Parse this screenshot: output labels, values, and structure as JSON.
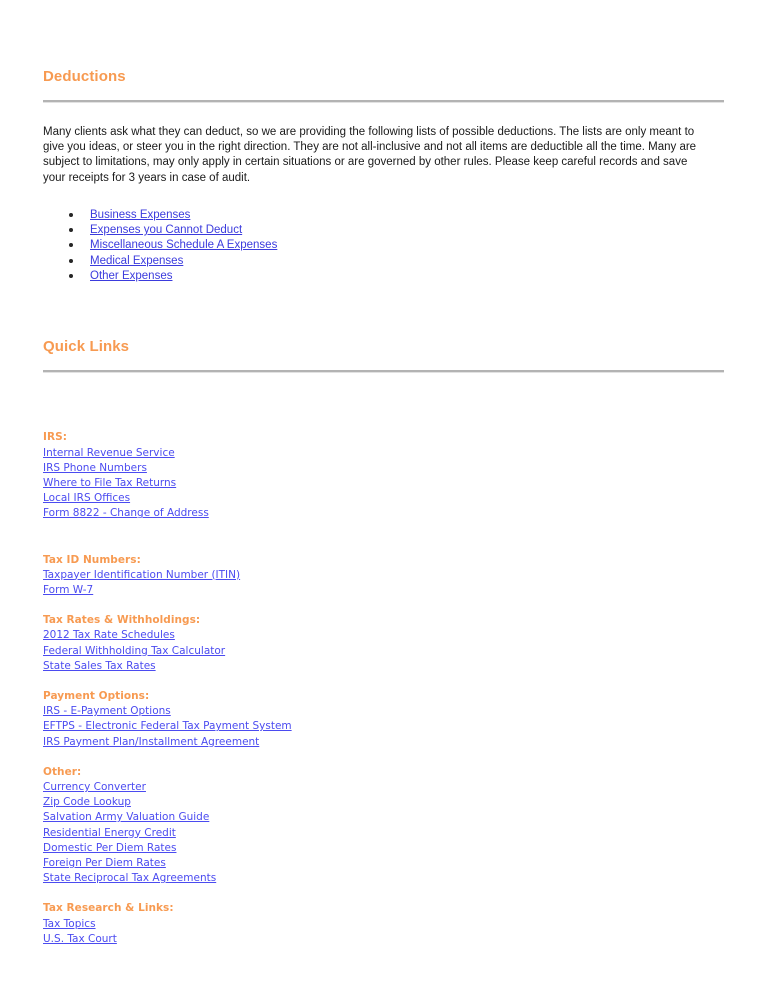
{
  "colors": {
    "heading_orange": "#f79a51",
    "link_blue": "#3b3bdd",
    "quicklink_blue": "#4b4bf0",
    "rule_gray": "#b3b3b3",
    "body_text": "#1a1a1a",
    "page_background": "#ffffff"
  },
  "deductions": {
    "heading": "Deductions",
    "intro": "Many clients ask what they can deduct, so we are providing the following lists of possible deductions. The lists are only meant to give you ideas, or steer you in the right direction. They are not all-inclusive and not all items are deductible all the time. Many are subject to limitations, may only apply in certain situations or are governed by other rules. Please keep careful records and save your receipts for 3 years in case of audit.",
    "links": [
      "Business Expenses",
      "Expenses you Cannot Deduct",
      "Miscellaneous Schedule A Expenses",
      "Medical Expenses",
      "Other Expenses"
    ]
  },
  "quick_links": {
    "heading": "Quick Links",
    "groups": [
      {
        "title": "IRS:",
        "links": [
          "Internal Revenue Service",
          "IRS Phone Numbers",
          "Where to File Tax Returns",
          "Local IRS Offices",
          "Form 8822 - Change of Address"
        ]
      },
      {
        "title": "Tax ID Numbers:",
        "links": [
          "Taxpayer Identification Number (ITIN)",
          "Form W-7"
        ]
      },
      {
        "title": "Tax Rates & Withholdings:",
        "links": [
          "2012 Tax Rate Schedules",
          "Federal Withholding Tax Calculator",
          "State Sales Tax Rates"
        ]
      },
      {
        "title": "Payment Options:",
        "links": [
          "IRS - E-Payment Options",
          "EFTPS - Electronic Federal Tax Payment System",
          "IRS Payment Plan/Installment Agreement"
        ]
      },
      {
        "title": "Other:",
        "links": [
          "Currency Converter",
          "Zip Code Lookup",
          "Salvation Army Valuation Guide",
          "Residential Energy Credit",
          "Domestic Per Diem Rates",
          "Foreign Per Diem Rates",
          "State Reciprocal Tax Agreements"
        ]
      },
      {
        "title": "Tax Research & Links:",
        "links": [
          "Tax Topics",
          "U.S. Tax Court"
        ]
      }
    ]
  }
}
